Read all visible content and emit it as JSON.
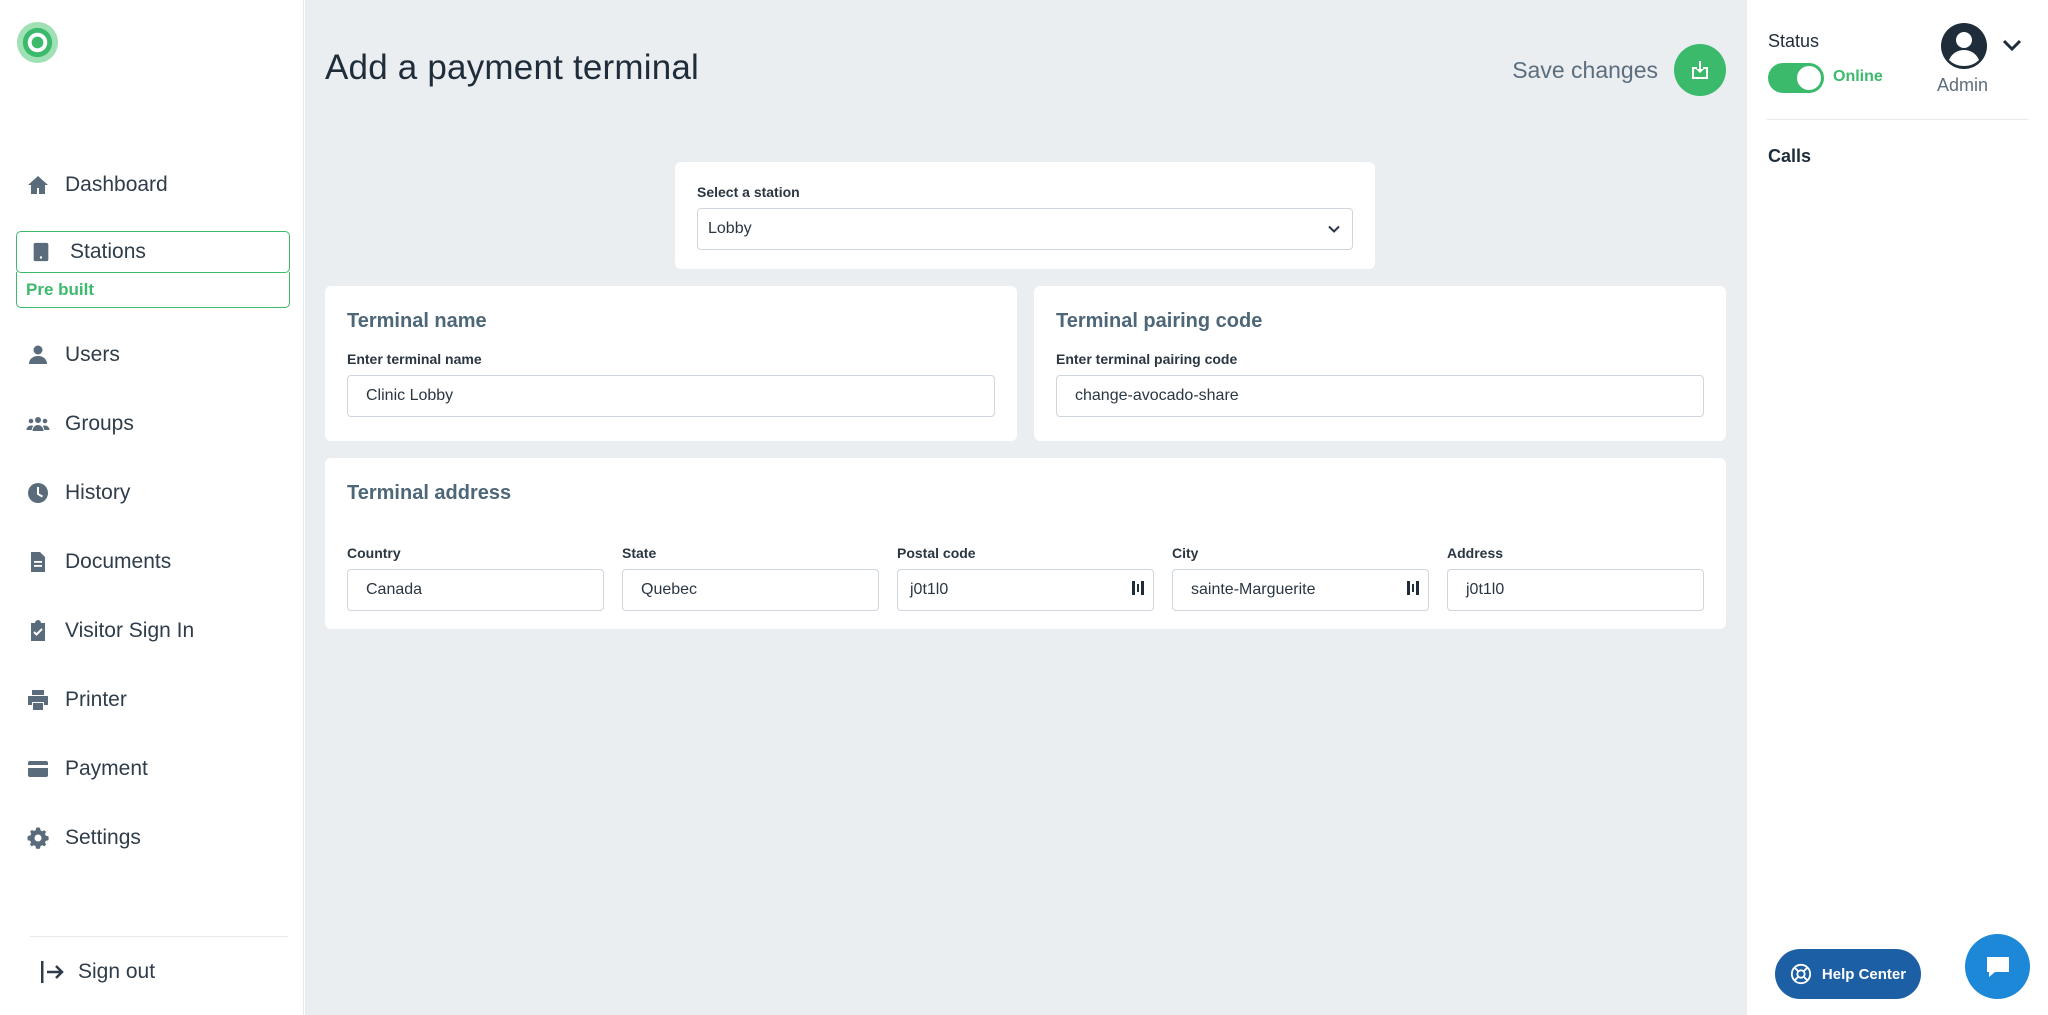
{
  "sidebar": {
    "items": [
      {
        "label": "Dashboard",
        "icon": "home-icon"
      },
      {
        "label": "Stations",
        "icon": "tablet-icon",
        "active": true,
        "sub": "Pre built"
      },
      {
        "label": "Users",
        "icon": "user-icon"
      },
      {
        "label": "Groups",
        "icon": "group-icon"
      },
      {
        "label": "History",
        "icon": "clock-icon"
      },
      {
        "label": "Documents",
        "icon": "document-icon"
      },
      {
        "label": "Visitor Sign In",
        "icon": "clipboard-check-icon"
      },
      {
        "label": "Printer",
        "icon": "printer-icon"
      },
      {
        "label": "Payment",
        "icon": "credit-card-icon"
      },
      {
        "label": "Settings",
        "icon": "gear-icon"
      }
    ],
    "signout": "Sign out"
  },
  "header": {
    "title": "Add a payment terminal",
    "save_label": "Save changes"
  },
  "station": {
    "label": "Select a station",
    "value": "Lobby"
  },
  "terminal_name": {
    "title": "Terminal name",
    "label": "Enter terminal name",
    "value": "Clinic Lobby"
  },
  "pairing": {
    "title": "Terminal pairing code",
    "label": "Enter terminal pairing code",
    "value": "change-avocado-share"
  },
  "address": {
    "title": "Terminal address",
    "fields": [
      {
        "label": "Country",
        "value": "Canada"
      },
      {
        "label": "State",
        "value": "Quebec"
      },
      {
        "label": "Postal code",
        "value": "j0t1l0"
      },
      {
        "label": "City",
        "value": "sainte-Marguerite"
      },
      {
        "label": "Address",
        "value": "j0t1l0"
      }
    ]
  },
  "right": {
    "status_label": "Status",
    "status_value": "Online",
    "user": "Admin",
    "calls": "Calls"
  },
  "help": {
    "label": "Help Center"
  },
  "colors": {
    "accent": "#3cba6c",
    "help_bg": "#1c5fa5",
    "chat_bg": "#1e88d8",
    "main_bg": "#ebeef1"
  }
}
